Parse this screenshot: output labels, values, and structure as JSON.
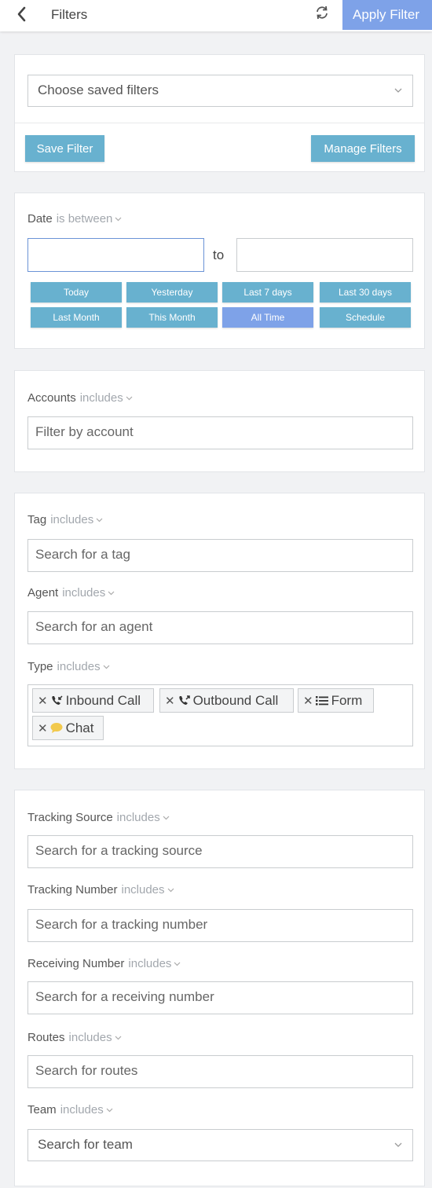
{
  "header": {
    "title": "Filters",
    "apply_label": "Apply Filter"
  },
  "saved": {
    "select_text": "Choose saved filters",
    "save_label": "Save Filter",
    "manage_label": "Manage Filters"
  },
  "date": {
    "label": "Date",
    "operator": "is between",
    "from_value": "",
    "to_text": "to",
    "to_value": "",
    "quick_buttons": [
      "Today",
      "Yesterday",
      "Last 7 days",
      "Last 30 days",
      "Last Month",
      "This Month",
      "All Time",
      "Schedule"
    ],
    "active_button": "All Time"
  },
  "accounts": {
    "label": "Accounts",
    "operator": "includes",
    "placeholder": "Filter by account"
  },
  "tag": {
    "label": "Tag",
    "operator": "includes",
    "placeholder": "Search for a tag"
  },
  "agent": {
    "label": "Agent",
    "operator": "includes",
    "placeholder": "Search for an agent"
  },
  "type": {
    "label": "Type",
    "operator": "includes",
    "chips": [
      {
        "label": "Inbound Call",
        "icon": "phone-inbound-icon"
      },
      {
        "label": "Outbound Call",
        "icon": "phone-outbound-icon"
      },
      {
        "label": "Form",
        "icon": "list-icon"
      },
      {
        "label": "Chat",
        "icon": "chat-bubble-icon"
      }
    ]
  },
  "tracking_source": {
    "label": "Tracking Source",
    "operator": "includes",
    "placeholder": "Search for a tracking source"
  },
  "tracking_number": {
    "label": "Tracking Number",
    "operator": "includes",
    "placeholder": "Search for a tracking number"
  },
  "receiving_number": {
    "label": "Receiving Number",
    "operator": "includes",
    "placeholder": "Search for a receiving number"
  },
  "routes": {
    "label": "Routes",
    "operator": "includes",
    "placeholder": "Search for routes"
  },
  "team": {
    "label": "Team",
    "operator": "includes",
    "select_text": "Search for team"
  },
  "colors": {
    "accent_blue": "#68b1cf",
    "active_blue": "#7ea2e8",
    "chat_yellow": "#f2c94c"
  }
}
